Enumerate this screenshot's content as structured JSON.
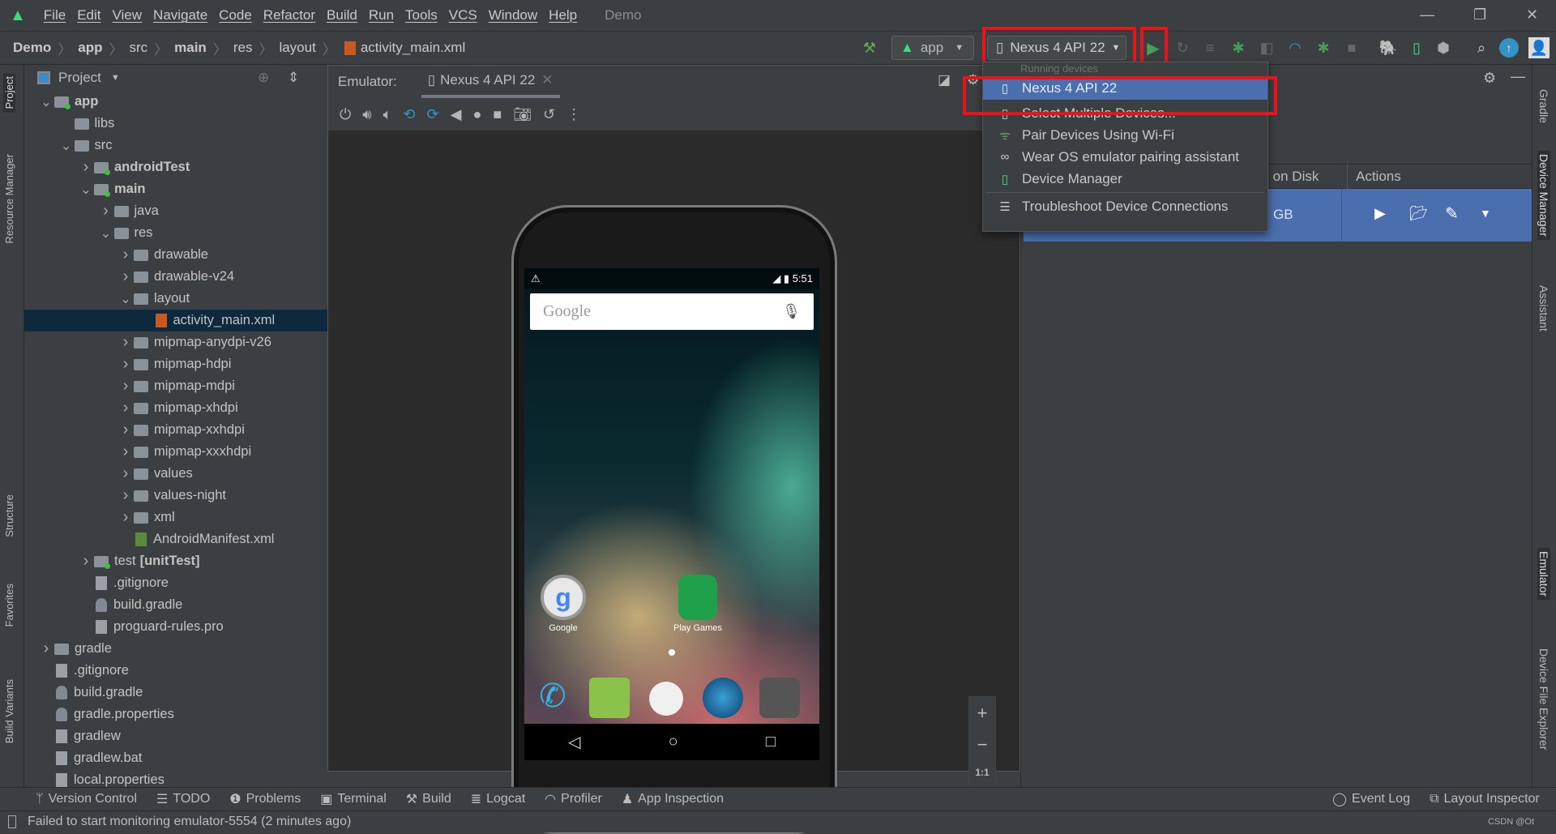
{
  "menu": {
    "items": [
      "File",
      "Edit",
      "View",
      "Navigate",
      "Code",
      "Refactor",
      "Build",
      "Run",
      "Tools",
      "VCS",
      "Window",
      "Help"
    ],
    "project_title": "Demo"
  },
  "breadcrumb": [
    "Demo",
    "app",
    "src",
    "main",
    "res",
    "layout",
    "activity_main.xml"
  ],
  "toolbar": {
    "run_config": "app",
    "device": "Nexus 4 API 22"
  },
  "left_stripe": [
    "Project",
    "Resource Manager",
    "Structure",
    "Favorites",
    "Build Variants"
  ],
  "right_stripe": [
    "Gradle",
    "Device Manager",
    "Assistant",
    "Emulator",
    "Device File Explorer"
  ],
  "project": {
    "title": "Project",
    "tree": [
      {
        "label": "app",
        "level": 0,
        "arrow": "down",
        "type": "module",
        "bold": true
      },
      {
        "label": "libs",
        "level": 1,
        "type": "folder"
      },
      {
        "label": "src",
        "level": 1,
        "arrow": "down",
        "type": "folder"
      },
      {
        "label": "androidTest",
        "level": 2,
        "arrow": "right",
        "type": "folder-mod",
        "bold": true
      },
      {
        "label": "main",
        "level": 2,
        "arrow": "down",
        "type": "folder-mod",
        "bold": true
      },
      {
        "label": "java",
        "level": 3,
        "arrow": "right",
        "type": "folder"
      },
      {
        "label": "res",
        "level": 3,
        "arrow": "down",
        "type": "folder"
      },
      {
        "label": "drawable",
        "level": 4,
        "arrow": "right",
        "type": "folder"
      },
      {
        "label": "drawable-v24",
        "level": 4,
        "arrow": "right",
        "type": "folder"
      },
      {
        "label": "layout",
        "level": 4,
        "arrow": "down",
        "type": "folder"
      },
      {
        "label": "activity_main.xml",
        "level": 5,
        "type": "xml",
        "selected": true
      },
      {
        "label": "mipmap-anydpi-v26",
        "level": 4,
        "arrow": "right",
        "type": "folder"
      },
      {
        "label": "mipmap-hdpi",
        "level": 4,
        "arrow": "right",
        "type": "folder"
      },
      {
        "label": "mipmap-mdpi",
        "level": 4,
        "arrow": "right",
        "type": "folder"
      },
      {
        "label": "mipmap-xhdpi",
        "level": 4,
        "arrow": "right",
        "type": "folder"
      },
      {
        "label": "mipmap-xxhdpi",
        "level": 4,
        "arrow": "right",
        "type": "folder"
      },
      {
        "label": "mipmap-xxxhdpi",
        "level": 4,
        "arrow": "right",
        "type": "folder"
      },
      {
        "label": "values",
        "level": 4,
        "arrow": "right",
        "type": "folder"
      },
      {
        "label": "values-night",
        "level": 4,
        "arrow": "right",
        "type": "folder"
      },
      {
        "label": "xml",
        "level": 4,
        "arrow": "right",
        "type": "folder"
      },
      {
        "label": "AndroidManifest.xml",
        "level": 4,
        "type": "manifest"
      },
      {
        "label": "test",
        "suffix": "[unitTest]",
        "level": 2,
        "arrow": "right",
        "type": "folder-mod"
      },
      {
        "label": ".gitignore",
        "level": 2,
        "type": "file"
      },
      {
        "label": "build.gradle",
        "level": 2,
        "type": "gradle"
      },
      {
        "label": "proguard-rules.pro",
        "level": 2,
        "type": "file"
      },
      {
        "label": "gradle",
        "level": 0,
        "arrow": "right",
        "type": "folder"
      },
      {
        "label": ".gitignore",
        "level": 0,
        "type": "file"
      },
      {
        "label": "build.gradle",
        "level": 0,
        "type": "gradle"
      },
      {
        "label": "gradle.properties",
        "level": 0,
        "type": "gradle"
      },
      {
        "label": "gradlew",
        "level": 0,
        "type": "file"
      },
      {
        "label": "gradlew.bat",
        "level": 0,
        "type": "file"
      },
      {
        "label": "local.properties",
        "level": 0,
        "type": "file"
      }
    ]
  },
  "emulator": {
    "label": "Emulator:",
    "tab": "Nexus 4 API 22",
    "zoom_fit": "1:1",
    "phone": {
      "time": "5:51",
      "search_placeholder": "Google",
      "apps": [
        "Google",
        "Play Games"
      ]
    }
  },
  "device_manager": {
    "columns": [
      "ze on Disk",
      "Actions"
    ],
    "row_size": "GB"
  },
  "dropdown": {
    "section": "Running devices",
    "items": [
      {
        "label": "Nexus 4 API 22",
        "icon": "phone-running-icon",
        "selected": true
      },
      {
        "label": "Select Multiple Devices...",
        "icon": "multi-device-icon"
      },
      {
        "label": "Pair Devices Using Wi-Fi",
        "icon": "wifi-icon"
      },
      {
        "label": "Wear OS emulator pairing assistant",
        "icon": "link-icon"
      },
      {
        "label": "Device Manager",
        "icon": "device-manager-icon"
      },
      {
        "label": "Troubleshoot Device Connections",
        "icon": "list-icon"
      }
    ]
  },
  "bottom_tools": [
    "Version Control",
    "TODO",
    "Problems",
    "Terminal",
    "Build",
    "Logcat",
    "Profiler",
    "App Inspection"
  ],
  "bottom_right": [
    "Event Log",
    "Layout Inspector"
  ],
  "status": {
    "message": "Failed to start monitoring emulator-5554 (2 minutes ago)",
    "watermark": "CSDN @Ot"
  },
  "colors": {
    "accent": "#4b6eaf",
    "highlight": "#e8141c",
    "run": "#499c54",
    "selection": "#0d293e"
  }
}
